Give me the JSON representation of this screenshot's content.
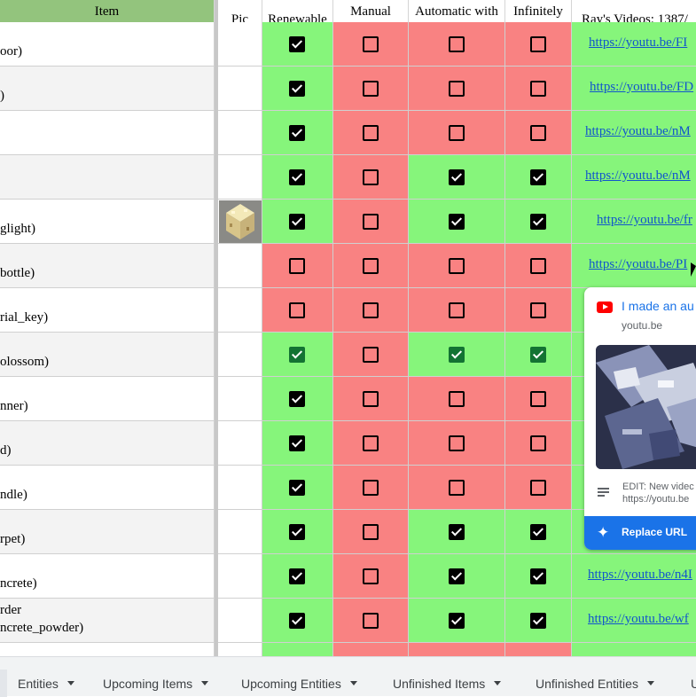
{
  "headers": {
    "item": "Item\n(item_name)",
    "pic": "Pic",
    "renewable": "Renewable",
    "manual_gui": "Manual\nGUI needed",
    "auto_player": "Automatic with\nPlayer Loading",
    "infinitely_auto": "Infinitely\nAutomatic",
    "videos": "Ray's Videos: 1387/"
  },
  "rows": [
    {
      "item": "oor)",
      "renewable": "green-on",
      "manual": "red",
      "auto": "red",
      "inf": "red",
      "link": "https://youtu.be/FI"
    },
    {
      "item": ")",
      "renewable": "green-on",
      "manual": "red",
      "auto": "red",
      "inf": "red",
      "link": "https://youtu.be/FD"
    },
    {
      "item": "",
      "renewable": "green-on",
      "manual": "red",
      "auto": "red",
      "inf": "red",
      "link": "https://youtu.be/nM"
    },
    {
      "item": "",
      "renewable": "green-on",
      "manual": "red",
      "auto": "green-on",
      "inf": "green-on",
      "link": "https://youtu.be/nM"
    },
    {
      "item": "glight)",
      "renewable": "green-on",
      "manual": "red",
      "auto": "green-on",
      "inf": "green-on",
      "link": "https://youtu.be/fr",
      "pic": true
    },
    {
      "item": "bottle)",
      "renewable": "red",
      "manual": "red",
      "auto": "red",
      "inf": "red",
      "link": "https://youtu.be/PI"
    },
    {
      "item": "rial_key)",
      "renewable": "red",
      "manual": "red",
      "auto": "red",
      "inf": "red",
      "link": ""
    },
    {
      "item": "olossom)",
      "renewable": "green-dg",
      "manual": "red",
      "auto": "green-dg",
      "inf": "green-dg",
      "link": ""
    },
    {
      "item": "nner)",
      "renewable": "green-on",
      "manual": "red",
      "auto": "red",
      "inf": "red",
      "link": ""
    },
    {
      "item": "d)",
      "renewable": "green-on",
      "manual": "red",
      "auto": "red",
      "inf": "red",
      "link": ""
    },
    {
      "item": "ndle)",
      "renewable": "green-on",
      "manual": "red",
      "auto": "red",
      "inf": "red",
      "link": ""
    },
    {
      "item": "rpet)",
      "renewable": "green-on",
      "manual": "red",
      "auto": "green-on",
      "inf": "green-on",
      "link": ""
    },
    {
      "item": "ncrete)",
      "renewable": "green-on",
      "manual": "red",
      "auto": "green-on",
      "inf": "green-on",
      "link": "https://youtu.be/n4I"
    },
    {
      "item": "rder\nncrete_powder)",
      "renewable": "green-on",
      "manual": "red",
      "auto": "green-on",
      "inf": "green-on",
      "link": "https://youtu.be/wf"
    },
    {
      "item": "",
      "renewable": "green",
      "manual": "red",
      "auto": "red",
      "inf": "red",
      "link": ""
    }
  ],
  "popup": {
    "title": "I made an au",
    "domain": "youtu.be",
    "note": "EDIT: New videc\nhttps://youtu.be",
    "replace_label": "Replace URL",
    "icon": "youtube-logo"
  },
  "tabs": [
    "Entities",
    "Upcoming Items",
    "Upcoming Entities",
    "Unfinished Items",
    "Unfinished Entities",
    "U"
  ],
  "colors": {
    "green": "#86f57b",
    "red": "#f98282",
    "item_header": "#93c47d",
    "link": "#1155cc",
    "accent": "#1a73e8"
  }
}
